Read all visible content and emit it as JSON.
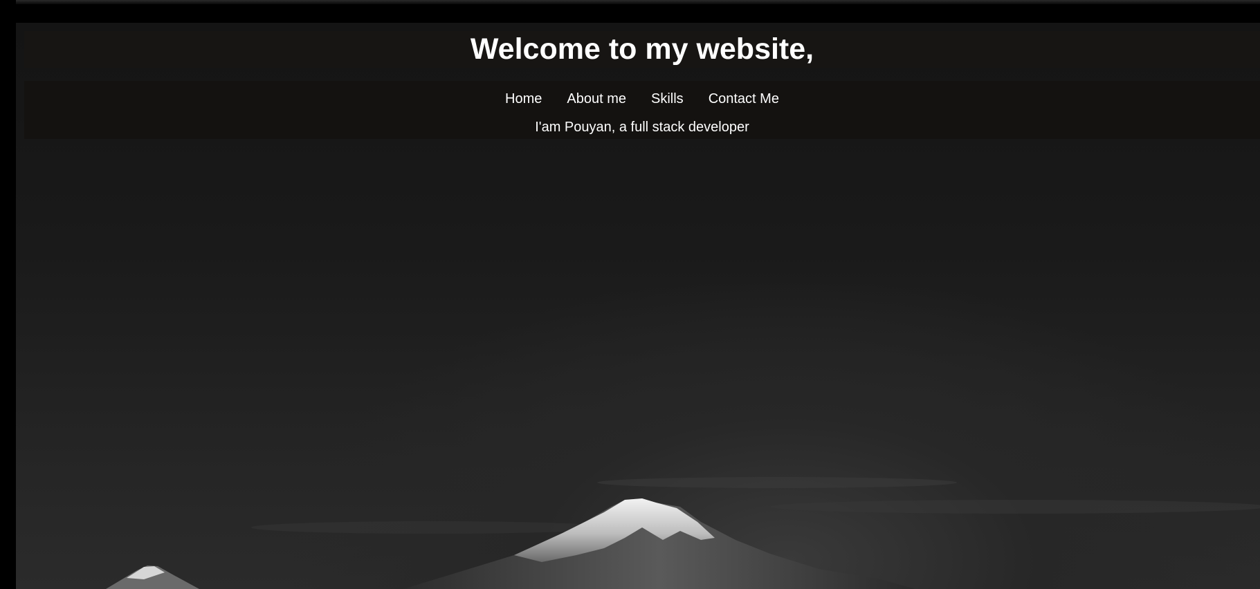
{
  "header": {
    "title": "Welcome to my website,"
  },
  "nav": {
    "items": [
      {
        "label": "Home"
      },
      {
        "label": "About me"
      },
      {
        "label": "Skills"
      },
      {
        "label": "Contact Me"
      }
    ]
  },
  "hero": {
    "tagline": "I'am Pouyan, a full stack developer",
    "background_image": "mountain-peak-image"
  },
  "colors": {
    "background": "#151515",
    "text": "#ffffff",
    "band": "#181614"
  }
}
